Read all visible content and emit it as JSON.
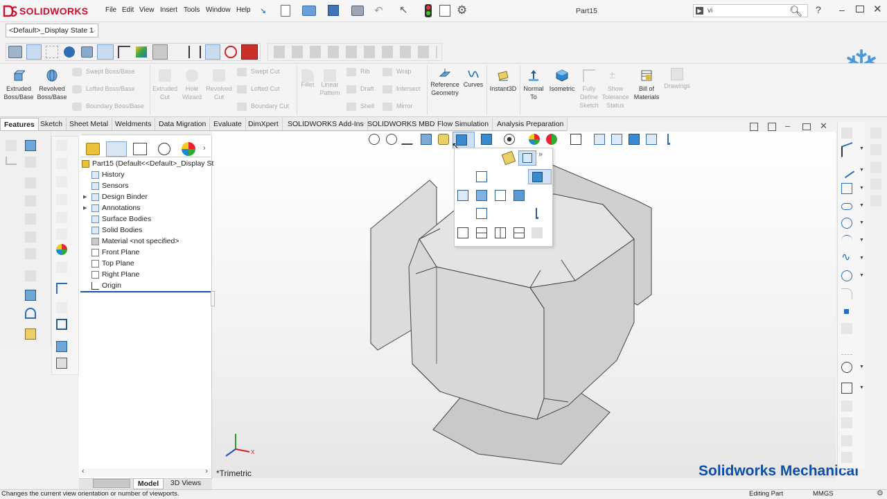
{
  "app": {
    "logo_text": "SOLIDWORKS",
    "document_title": "Part15"
  },
  "menu": [
    "File",
    "Edit",
    "View",
    "Insert",
    "Tools",
    "Window",
    "Help"
  ],
  "search": {
    "value": "vi"
  },
  "config_select": {
    "value": "<Default>_Display State 1"
  },
  "ribbon": {
    "extruded_boss": "Extruded Boss/Base",
    "revolved_boss": "Revolved Boss/Base",
    "swept_boss": "Swept Boss/Base",
    "lofted_boss": "Lofted Boss/Base",
    "boundary_boss": "Boundary Boss/Base",
    "extruded_cut": "Extruded Cut",
    "hole_wizard": "Hole Wizard",
    "revolved_cut": "Revolved Cut",
    "swept_cut": "Swept Cut",
    "lofted_cut": "Lofted Cut",
    "boundary_cut": "Boundary Cut",
    "fillet": "Fillet",
    "linear_pattern": "Linear Pattern",
    "rib": "Rib",
    "draft": "Draft",
    "shell": "Shell",
    "wrap": "Wrap",
    "intersect": "Intersect",
    "mirror": "Mirror",
    "ref_geometry": "Reference Geometry",
    "curves": "Curves",
    "instant3d": "Instant3D",
    "normal_to": "Normal To",
    "isometric": "Isometric",
    "fully_define": "Fully Define Sketch",
    "show_tolerance": "Show Tolerance Status",
    "bom": "Bill of Materials",
    "drawings": "Drawings"
  },
  "tabs": [
    "Features",
    "Sketch",
    "Sheet Metal",
    "Weldments",
    "Data Migration",
    "Evaluate",
    "DimXpert",
    "SOLIDWORKS Add-Ins",
    "SOLIDWORKS MBD",
    "Flow Simulation",
    "Analysis Preparation"
  ],
  "tree": {
    "root": "Part15  (Default<<Default>_Display St",
    "items": [
      "History",
      "Sensors",
      "Design Binder",
      "Annotations",
      "Surface Bodies",
      "Solid Bodies",
      "Material <not specified>",
      "Front Plane",
      "Top Plane",
      "Right Plane",
      "Origin"
    ]
  },
  "bottom_tabs": {
    "model": "Model",
    "views3d": "3D Views"
  },
  "viewport": {
    "view_label": "*Trimetric",
    "watermark": "Solidworks Mechanical"
  },
  "status": {
    "message": "Changes the current view orientation or number of viewports.",
    "mode": "Editing Part",
    "units": "MMGS"
  },
  "colors": {
    "accent": "#1a56a8",
    "logo_red": "#c8102e",
    "watermark": "#0d4fa8"
  }
}
